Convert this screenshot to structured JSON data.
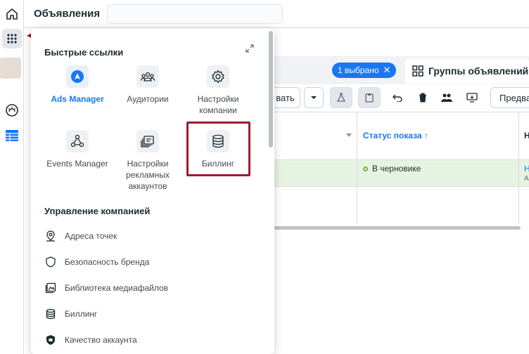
{
  "header": {
    "title": "Объявления"
  },
  "quick_links": {
    "title": "Быстрые ссылки",
    "tiles": [
      {
        "label": "Ads Manager",
        "icon": "ads-manager-icon"
      },
      {
        "label": "Аудитории",
        "icon": "audiences-icon"
      },
      {
        "label": "Настройки компании",
        "icon": "gear-icon"
      },
      {
        "label": "Events Manager",
        "icon": "events-manager-icon"
      },
      {
        "label": "Настройки рекламных аккаунтов",
        "icon": "ad-account-settings-icon"
      },
      {
        "label": "Биллинг",
        "icon": "billing-icon"
      }
    ]
  },
  "business_management": {
    "title": "Управление компанией",
    "items": [
      {
        "label": "Адреса точек",
        "icon": "location-pin-icon"
      },
      {
        "label": "Безопасность бренда",
        "icon": "shield-icon"
      },
      {
        "label": "Библиотека медиафайлов",
        "icon": "media-library-icon"
      },
      {
        "label": "Биллинг",
        "icon": "billing-icon"
      },
      {
        "label": "Качество аккаунта",
        "icon": "account-quality-icon"
      }
    ]
  },
  "background": {
    "selected_chip": "1 выбрано",
    "adsets_tab": "Группы объявлений",
    "toolbar_text_left": "вать",
    "toolbar_text_right": "Предвар",
    "column_status": "Статус показа ↑",
    "column_next": "Н",
    "row_status": "В черновике",
    "row_next": "Н",
    "row_next_sub": "А"
  },
  "colors": {
    "accent": "#1877f2",
    "highlight": "#9e1b32",
    "arrow": "#a0162c",
    "draft_row": "#e7f3e1"
  }
}
